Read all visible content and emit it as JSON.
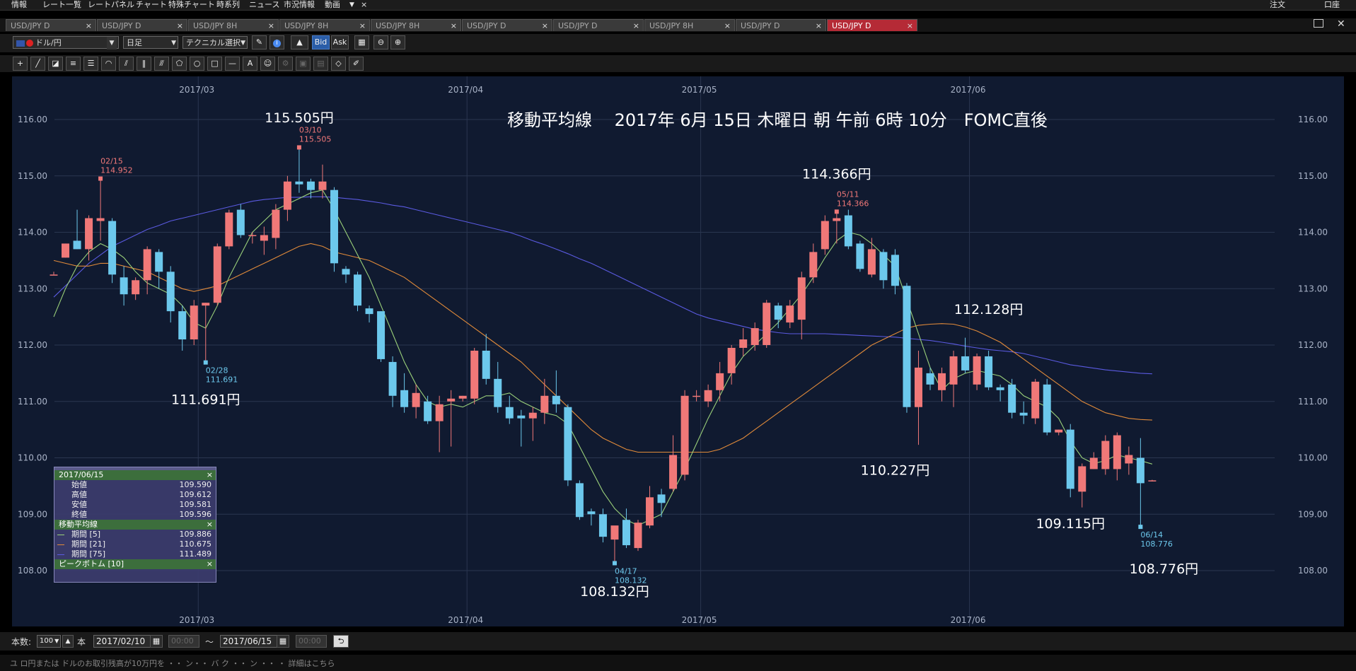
{
  "menubar": {
    "items": [
      "情報",
      "レート一覧",
      "レートパネル",
      "チャート",
      "特殊チャート",
      "時系列",
      "ニュース",
      "市況情報",
      "動画"
    ],
    "right_items": [
      "注文",
      "口座"
    ]
  },
  "tabs": [
    {
      "label": "USD/JPY D",
      "active": false
    },
    {
      "label": "USD/JPY D",
      "active": false
    },
    {
      "label": "USD/JPY 8H",
      "active": false
    },
    {
      "label": "USD/JPY 8H",
      "active": false
    },
    {
      "label": "USD/JPY 8H",
      "active": false
    },
    {
      "label": "USD/JPY D",
      "active": false
    },
    {
      "label": "USD/JPY D",
      "active": false
    },
    {
      "label": "USD/JPY 8H",
      "active": false
    },
    {
      "label": "USD/JPY D",
      "active": false
    },
    {
      "label": "USD/JPY D",
      "active": true
    }
  ],
  "toolbar": {
    "currency": "ドル/円",
    "timeframe": "日足",
    "technical": "テクニカル選択",
    "bid": "Bid",
    "ask": "Ask"
  },
  "bottom": {
    "count_label": "本数:",
    "count_value": "100",
    "unit": "本",
    "from_date": "2017/02/10",
    "from_time": "00:00",
    "tilde": "～",
    "to_date": "2017/06/15",
    "to_time": "00:00"
  },
  "footer_text": "ユ ロ円または ドルのお取引残高が10万円を ・・ ン・・ バ ク ・・ ン ・・ ・ 詳細はこちら",
  "info_panel": {
    "date": "2017/06/15",
    "ohlc": [
      {
        "label": "始値",
        "value": "109.590"
      },
      {
        "label": "高値",
        "value": "109.612"
      },
      {
        "label": "安値",
        "value": "109.581"
      },
      {
        "label": "終値",
        "value": "109.596"
      }
    ],
    "ma_title": "移動平均線",
    "ma": [
      {
        "label": "期間 [5]",
        "value": "109.886",
        "color": "#9ad07a"
      },
      {
        "label": "期間 [21]",
        "value": "110.675",
        "color": "#e08a3a"
      },
      {
        "label": "期間 [75]",
        "value": "111.489",
        "color": "#5a5ae0"
      }
    ],
    "peak_title": "ピークボトム [10]"
  },
  "chart_data": {
    "type": "candlestick",
    "title": "移動平均線　 2017年 6月 15日 木曜日 朝 午前 6時 10分　FOMC直後",
    "ylim": [
      107.5,
      116.5
    ],
    "y_ticks": [
      "116.00",
      "115.00",
      "114.00",
      "113.00",
      "112.00",
      "111.00",
      "110.00",
      "109.00",
      "108.00"
    ],
    "x_ticks": [
      {
        "label": "2017/03",
        "index": 12
      },
      {
        "label": "2017/04",
        "index": 35
      },
      {
        "label": "2017/05",
        "index": 55
      },
      {
        "label": "2017/06",
        "index": 78
      }
    ],
    "colors": {
      "up": "#f07878",
      "down": "#6cc8ec",
      "ma5": "#9ad07a",
      "ma21": "#e08a3a",
      "ma75": "#5a5ae0",
      "grid": "#2a3650",
      "text": "#aab4c8",
      "peak": "#f07878",
      "bottom": "#6cc8ec"
    },
    "candles": [
      [
        113.25,
        113.3,
        113.25,
        113.25
      ],
      [
        113.55,
        113.8,
        113.55,
        113.8
      ],
      [
        113.85,
        114.4,
        113.7,
        113.7
      ],
      [
        113.7,
        114.3,
        113.5,
        114.25
      ],
      [
        114.2,
        114.95,
        113.85,
        114.25
      ],
      [
        114.2,
        114.25,
        113.1,
        113.25
      ],
      [
        113.2,
        113.4,
        112.7,
        112.9
      ],
      [
        112.9,
        113.2,
        112.8,
        113.15
      ],
      [
        113.15,
        113.75,
        112.9,
        113.7
      ],
      [
        113.65,
        113.7,
        113.0,
        113.3
      ],
      [
        113.3,
        113.4,
        112.4,
        112.6
      ],
      [
        112.6,
        112.7,
        111.9,
        112.1
      ],
      [
        112.1,
        112.8,
        112.0,
        112.7
      ],
      [
        112.7,
        112.75,
        111.69,
        112.75
      ],
      [
        112.75,
        113.8,
        112.7,
        113.75
      ],
      [
        113.75,
        114.4,
        113.7,
        114.35
      ],
      [
        114.4,
        114.5,
        113.9,
        113.95
      ],
      [
        113.95,
        114.0,
        113.8,
        113.95
      ],
      [
        113.85,
        114.1,
        113.6,
        113.95
      ],
      [
        113.9,
        114.5,
        113.7,
        114.4
      ],
      [
        114.4,
        115.0,
        114.2,
        114.9
      ],
      [
        114.9,
        115.51,
        114.7,
        114.85
      ],
      [
        114.9,
        114.95,
        114.6,
        114.75
      ],
      [
        114.75,
        115.2,
        114.6,
        114.9
      ],
      [
        114.75,
        114.8,
        113.3,
        113.45
      ],
      [
        113.35,
        113.4,
        113.1,
        113.25
      ],
      [
        113.25,
        113.3,
        112.6,
        112.7
      ],
      [
        112.65,
        112.7,
        112.4,
        112.55
      ],
      [
        112.6,
        112.6,
        111.7,
        111.75
      ],
      [
        111.7,
        111.8,
        110.9,
        111.1
      ],
      [
        111.2,
        111.5,
        110.8,
        110.9
      ],
      [
        110.9,
        111.3,
        110.7,
        111.15
      ],
      [
        111.0,
        111.1,
        110.6,
        110.65
      ],
      [
        110.65,
        111.1,
        110.1,
        110.95
      ],
      [
        111.0,
        111.2,
        110.2,
        111.05
      ],
      [
        111.05,
        111.1,
        111.0,
        111.1
      ],
      [
        111.05,
        111.95,
        110.95,
        111.9
      ],
      [
        111.9,
        112.2,
        111.3,
        111.4
      ],
      [
        111.4,
        111.7,
        110.8,
        110.9
      ],
      [
        110.9,
        111.1,
        110.6,
        110.7
      ],
      [
        110.75,
        110.85,
        110.2,
        110.7
      ],
      [
        110.7,
        110.9,
        110.3,
        110.8
      ],
      [
        110.8,
        111.4,
        110.6,
        111.1
      ],
      [
        111.1,
        111.55,
        110.8,
        110.95
      ],
      [
        110.9,
        110.95,
        109.5,
        109.6
      ],
      [
        109.55,
        109.6,
        108.9,
        108.95
      ],
      [
        109.05,
        109.1,
        108.8,
        109.0
      ],
      [
        109.0,
        109.1,
        108.5,
        108.6
      ],
      [
        108.55,
        108.6,
        108.13,
        108.8
      ],
      [
        108.9,
        109.1,
        108.4,
        108.45
      ],
      [
        108.4,
        108.9,
        108.35,
        108.85
      ],
      [
        108.8,
        109.5,
        108.75,
        109.3
      ],
      [
        109.35,
        109.45,
        108.95,
        109.2
      ],
      [
        109.45,
        110.4,
        109.4,
        110.05
      ],
      [
        109.7,
        111.2,
        109.6,
        111.1
      ],
      [
        111.1,
        111.2,
        111.0,
        111.1
      ],
      [
        111.0,
        111.3,
        110.9,
        111.2
      ],
      [
        111.2,
        111.7,
        111.0,
        111.5
      ],
      [
        111.5,
        112.0,
        111.3,
        111.95
      ],
      [
        111.95,
        112.3,
        111.8,
        112.1
      ],
      [
        112.0,
        112.4,
        111.9,
        112.3
      ],
      [
        112.0,
        112.8,
        111.95,
        112.75
      ],
      [
        112.7,
        112.75,
        112.3,
        112.45
      ],
      [
        112.4,
        112.8,
        112.3,
        112.7
      ],
      [
        112.45,
        113.3,
        112.1,
        113.2
      ],
      [
        113.2,
        113.8,
        113.1,
        113.65
      ],
      [
        113.7,
        114.3,
        113.6,
        114.2
      ],
      [
        114.2,
        114.37,
        113.8,
        114.25
      ],
      [
        114.3,
        114.4,
        113.7,
        113.75
      ],
      [
        113.8,
        113.85,
        113.3,
        113.35
      ],
      [
        113.25,
        113.9,
        113.2,
        113.7
      ],
      [
        113.65,
        113.7,
        113.0,
        113.15
      ],
      [
        113.6,
        113.7,
        112.9,
        113.05
      ],
      [
        113.05,
        113.1,
        110.8,
        110.9
      ],
      [
        110.9,
        111.9,
        110.23,
        111.6
      ],
      [
        111.5,
        111.6,
        111.2,
        111.3
      ],
      [
        111.2,
        111.6,
        111.0,
        111.5
      ],
      [
        111.3,
        111.9,
        110.9,
        111.8
      ],
      [
        111.8,
        112.13,
        111.5,
        111.55
      ],
      [
        111.3,
        111.85,
        111.2,
        111.8
      ],
      [
        111.8,
        111.9,
        111.2,
        111.25
      ],
      [
        111.25,
        111.3,
        111.0,
        111.2
      ],
      [
        111.3,
        111.4,
        110.7,
        110.8
      ],
      [
        110.8,
        111.0,
        110.6,
        110.75
      ],
      [
        110.7,
        111.4,
        110.6,
        111.35
      ],
      [
        111.3,
        111.4,
        110.4,
        110.45
      ],
      [
        110.45,
        110.5,
        110.4,
        110.5
      ],
      [
        110.5,
        110.6,
        109.3,
        109.45
      ],
      [
        109.4,
        109.9,
        109.12,
        109.85
      ],
      [
        109.8,
        110.1,
        109.8,
        110.0
      ],
      [
        109.8,
        110.4,
        109.7,
        110.3
      ],
      [
        109.8,
        110.45,
        109.6,
        110.4
      ],
      [
        109.9,
        110.2,
        109.7,
        110.05
      ],
      [
        110.0,
        110.35,
        108.78,
        109.55
      ],
      [
        109.59,
        109.61,
        109.58,
        109.6
      ]
    ],
    "ma5": [
      112.5,
      113.0,
      113.4,
      113.65,
      113.8,
      113.7,
      113.55,
      113.3,
      113.1,
      113.0,
      112.9,
      112.7,
      112.4,
      112.3,
      112.7,
      113.2,
      113.6,
      114.0,
      114.2,
      114.4,
      114.5,
      114.6,
      114.7,
      114.75,
      114.4,
      114.0,
      113.6,
      113.2,
      112.7,
      112.2,
      111.7,
      111.3,
      111.0,
      110.9,
      110.95,
      110.9,
      111.0,
      111.1,
      111.1,
      111.15,
      111.0,
      110.9,
      110.8,
      110.75,
      110.6,
      110.2,
      109.8,
      109.4,
      109.1,
      108.9,
      108.8,
      108.9,
      109.0,
      109.4,
      109.8,
      110.25,
      110.7,
      111.1,
      111.5,
      111.8,
      112.0,
      112.2,
      112.4,
      112.65,
      112.9,
      113.2,
      113.55,
      113.85,
      114.0,
      113.95,
      113.8,
      113.6,
      113.4,
      112.8,
      112.2,
      111.6,
      111.2,
      111.4,
      111.5,
      111.55,
      111.5,
      111.45,
      111.3,
      111.1,
      111.0,
      110.9,
      110.7,
      110.3,
      110.0,
      109.9,
      109.95,
      110.05,
      110.0,
      109.95,
      109.89
    ],
    "ma21": [
      113.5,
      113.45,
      113.4,
      113.4,
      113.45,
      113.45,
      113.4,
      113.35,
      113.3,
      113.2,
      113.1,
      113.0,
      112.95,
      113.0,
      113.05,
      113.15,
      113.25,
      113.35,
      113.45,
      113.55,
      113.65,
      113.75,
      113.8,
      113.75,
      113.65,
      113.6,
      113.55,
      113.5,
      113.4,
      113.3,
      113.2,
      113.05,
      112.9,
      112.75,
      112.6,
      112.45,
      112.3,
      112.15,
      112.0,
      111.85,
      111.7,
      111.5,
      111.3,
      111.1,
      110.9,
      110.7,
      110.5,
      110.35,
      110.25,
      110.15,
      110.1,
      110.1,
      110.1,
      110.1,
      110.1,
      110.1,
      110.1,
      110.15,
      110.25,
      110.35,
      110.5,
      110.65,
      110.8,
      110.95,
      111.1,
      111.25,
      111.4,
      111.55,
      111.7,
      111.85,
      112.0,
      112.1,
      112.2,
      112.3,
      112.35,
      112.37,
      112.38,
      112.37,
      112.32,
      112.25,
      112.15,
      112.05,
      111.9,
      111.75,
      111.6,
      111.45,
      111.3,
      111.15,
      111.0,
      110.9,
      110.8,
      110.75,
      110.7,
      110.68,
      110.67
    ],
    "ma75": [
      112.85,
      113.05,
      113.25,
      113.45,
      113.6,
      113.75,
      113.85,
      113.95,
      114.05,
      114.12,
      114.2,
      114.25,
      114.3,
      114.35,
      114.4,
      114.45,
      114.5,
      114.55,
      114.58,
      114.6,
      114.62,
      114.62,
      114.63,
      114.63,
      114.62,
      114.6,
      114.58,
      114.55,
      114.52,
      114.48,
      114.45,
      114.4,
      114.35,
      114.3,
      114.25,
      114.2,
      114.15,
      114.1,
      114.05,
      114.0,
      113.93,
      113.85,
      113.78,
      113.7,
      113.62,
      113.53,
      113.45,
      113.35,
      113.25,
      113.15,
      113.05,
      112.95,
      112.85,
      112.75,
      112.65,
      112.55,
      112.48,
      112.43,
      112.38,
      112.33,
      112.28,
      112.25,
      112.22,
      112.2,
      112.2,
      112.2,
      112.2,
      112.19,
      112.18,
      112.17,
      112.16,
      112.15,
      112.14,
      112.12,
      112.1,
      112.08,
      112.05,
      112.02,
      111.98,
      111.95,
      111.92,
      111.9,
      111.88,
      111.85,
      111.8,
      111.75,
      111.7,
      111.65,
      111.62,
      111.59,
      111.56,
      111.54,
      111.52,
      111.5,
      111.49
    ],
    "markers": [
      {
        "index": 4,
        "price": 114.952,
        "type": "peak",
        "date": "02/15",
        "value": "114.952"
      },
      {
        "index": 13,
        "price": 111.691,
        "type": "bottom",
        "date": "02/28",
        "value": "111.691"
      },
      {
        "index": 21,
        "price": 115.505,
        "type": "peak",
        "date": "03/10",
        "value": "115.505"
      },
      {
        "index": 48,
        "price": 108.132,
        "type": "bottom",
        "date": "04/17",
        "value": "108.132"
      },
      {
        "index": 67,
        "price": 114.366,
        "type": "peak",
        "date": "05/11",
        "value": "114.366"
      },
      {
        "index": 93,
        "price": 108.776,
        "type": "bottom",
        "date": "06/14",
        "value": "108.776"
      }
    ],
    "annotations": [
      {
        "text": "115.505円",
        "index": 21,
        "price": 115.95
      },
      {
        "text": "111.691円",
        "index": 13,
        "price": 110.95
      },
      {
        "text": "114.366円",
        "index": 67,
        "price": 114.95
      },
      {
        "text": "108.132円",
        "index": 48,
        "price": 107.55
      },
      {
        "text": "112.128円",
        "index": 80,
        "price": 112.55
      },
      {
        "text": "110.227円",
        "index": 72,
        "price": 109.7
      },
      {
        "text": "109.115円",
        "index": 87,
        "price": 108.75
      },
      {
        "text": "108.776円",
        "index": 95,
        "price": 107.95
      }
    ]
  }
}
